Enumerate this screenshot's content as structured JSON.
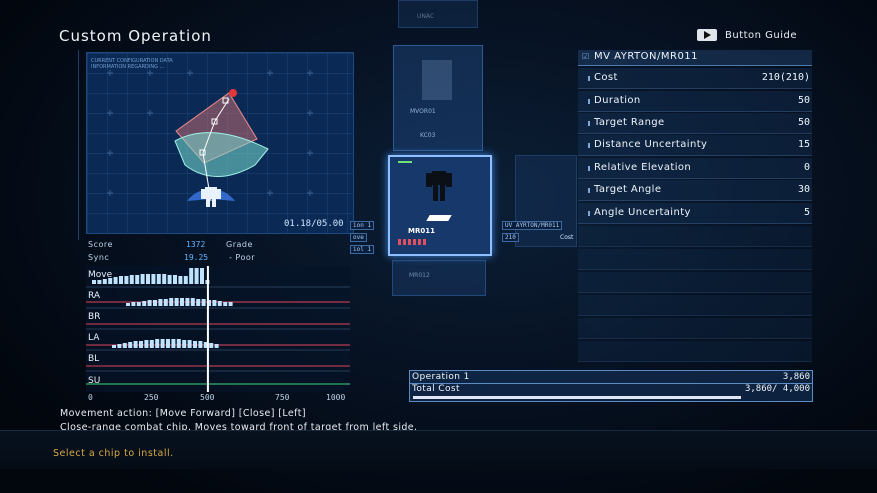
{
  "header": {
    "title": "Custom Operation",
    "button_guide": "Button Guide"
  },
  "map": {
    "header_lines": [
      "CURRENT CONFIGURATION DATA",
      "INFORMATION REGARDING ..."
    ],
    "time": "01.18/05.00",
    "tags": [
      "ion 1",
      "ove",
      "iol 1"
    ]
  },
  "score": {
    "score_label": "Score",
    "score_value": "1372",
    "grade_label": "Grade",
    "sync_label": "Sync",
    "sync_value": "19.25",
    "grade_value": "- Poor"
  },
  "timeline": {
    "rows": [
      "Move",
      "RA",
      "BR",
      "LA",
      "BL",
      "SU"
    ],
    "axis": [
      "0",
      "250",
      "500",
      "750",
      "1000"
    ],
    "cursor": 480
  },
  "chips": {
    "top_label": "UNAC",
    "upper_label": "MVOR01",
    "upper_sub": "KC03",
    "main_label": "MR011",
    "lower_label": "MR012",
    "side_label_1": "UV AYRTON/MR011",
    "side_label_2": "210",
    "side_label_3": "Cost"
  },
  "panel": {
    "header": "MV AYRTON/MR011",
    "rows": [
      {
        "key": "Cost",
        "value": "210(210)"
      },
      {
        "key": "Duration",
        "value": "50"
      },
      {
        "key": "Target Range",
        "value": "50"
      },
      {
        "key": "Distance Uncertainty",
        "value": "15"
      },
      {
        "key": "Relative Elevation",
        "value": "0"
      },
      {
        "key": "Target Angle",
        "value": "30"
      },
      {
        "key": "Angle Uncertainty",
        "value": "5"
      }
    ]
  },
  "cost": {
    "op_label": "Operation 1",
    "op_value": "3,860",
    "total_label": "Total Cost",
    "total_value": "3,860/  4,000",
    "fill": 0.965
  },
  "description": {
    "line1": "Movement action: [Move Forward] [Close] [Left]",
    "line2": "Close-range combat chip. Moves toward front of target from left side."
  },
  "prompt": "Select a chip to install.",
  "colors": {
    "accent": "#5fb4ff",
    "prompt": "#d8a944",
    "red_line": "#e0455a",
    "green_line": "#3fd67a"
  }
}
